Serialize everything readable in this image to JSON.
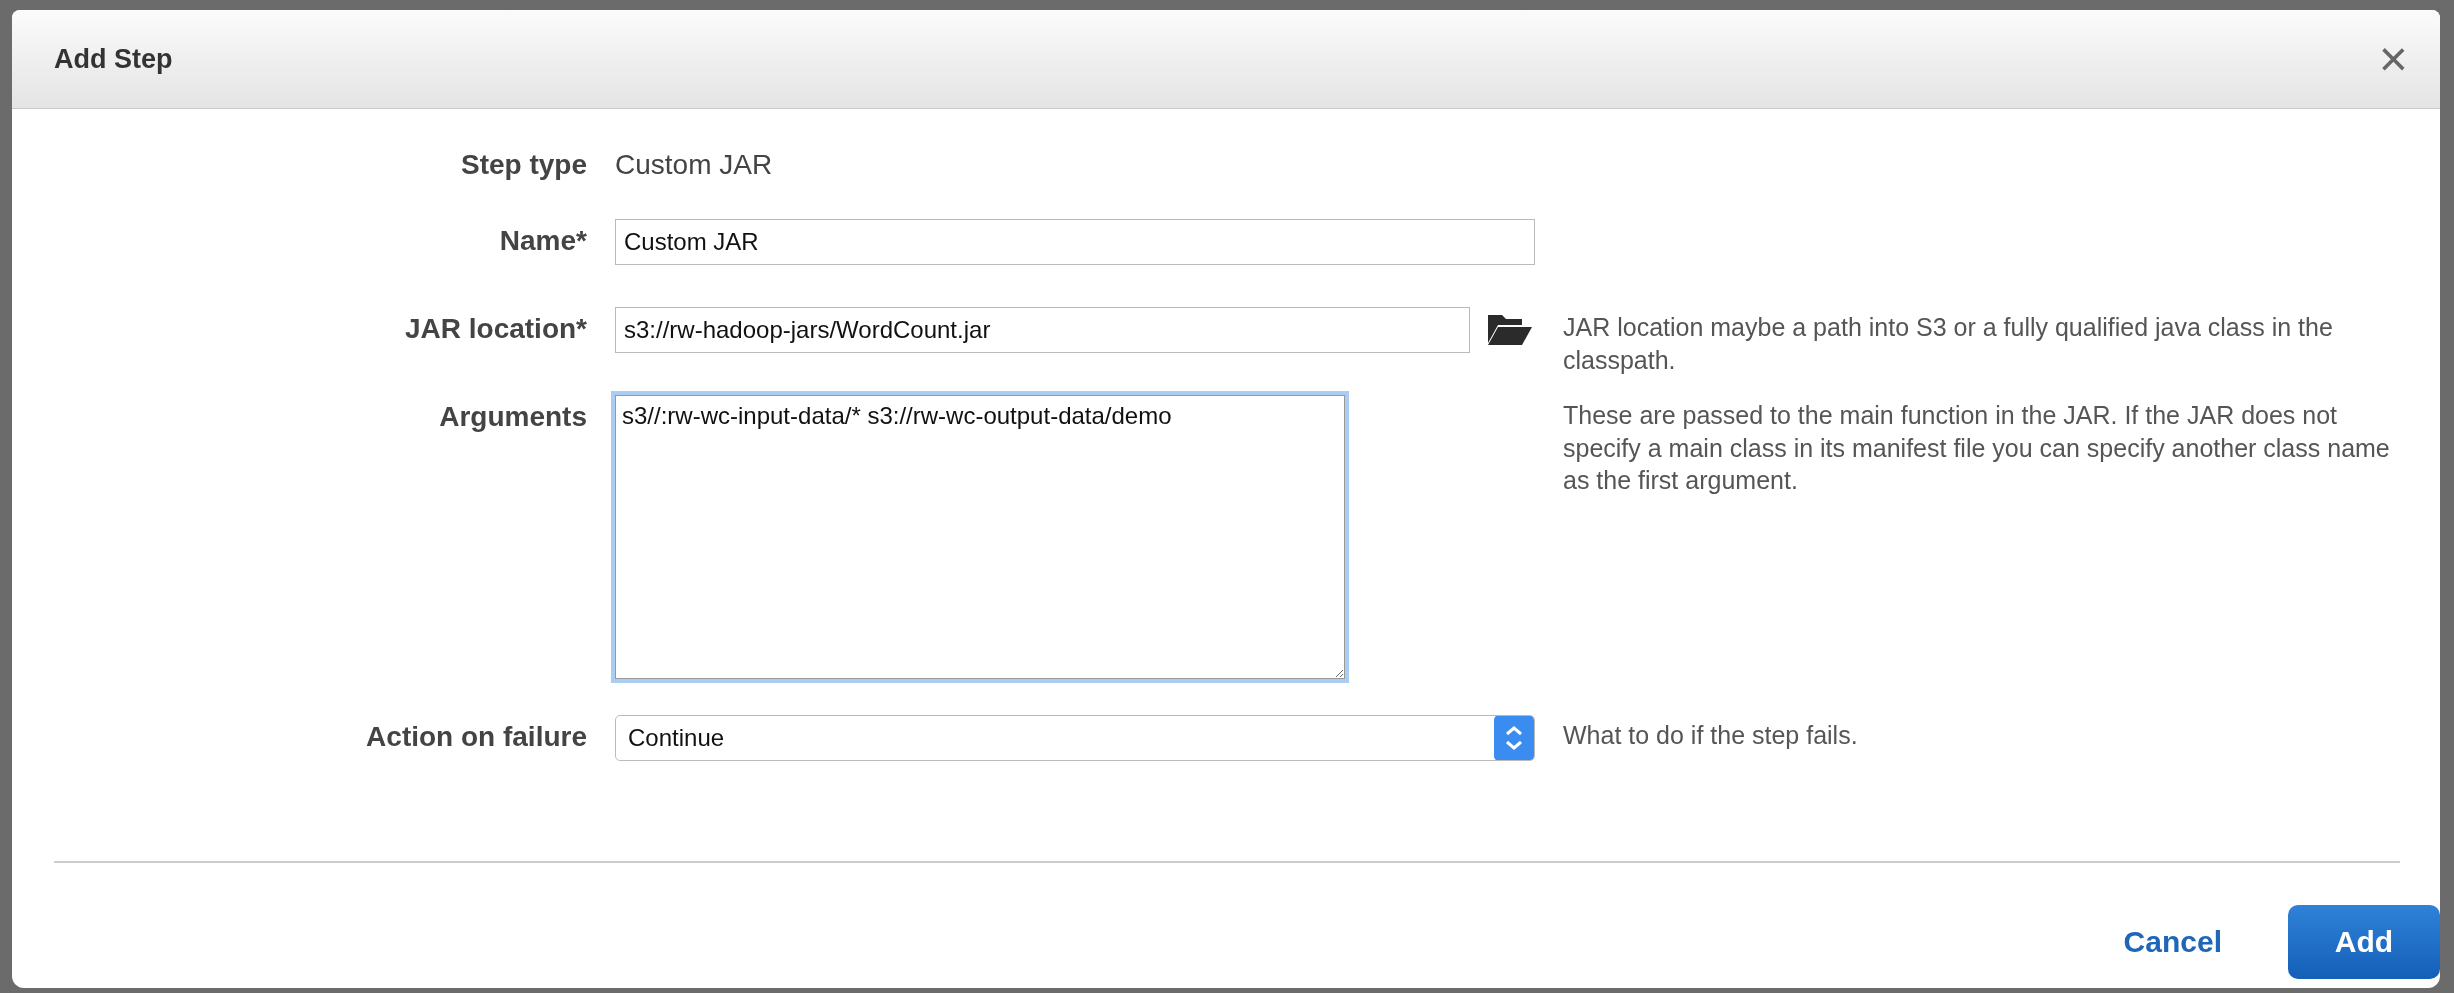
{
  "dialog": {
    "title": "Add Step",
    "close": "×"
  },
  "fields": [
    {
      "kind": "static",
      "label": "Step type",
      "value": "Custom JAR"
    },
    {
      "kind": "text",
      "label": "Name*",
      "value": "Custom JAR"
    },
    {
      "kind": "browse",
      "label": "JAR location*",
      "value": "s3://rw-hadoop-jars/WordCount.jar",
      "help": "JAR location maybe a path into S3 or a fully qualified java class in the classpath."
    },
    {
      "kind": "textarea",
      "label": "Arguments",
      "value": "s3//:rw-wc-input-data/* s3://rw-wc-output-data/demo",
      "focused": true,
      "help": "These are passed to the main function in the JAR. If the JAR does not specify a main class in its manifest file you can specify another class name as the first argument."
    },
    {
      "kind": "select",
      "label": "Action on failure",
      "value": "Continue",
      "help": "What to do if the step fails."
    }
  ],
  "buttons": [
    {
      "label": "Cancel",
      "kind": "link"
    },
    {
      "label": "Add",
      "kind": "primary"
    }
  ]
}
